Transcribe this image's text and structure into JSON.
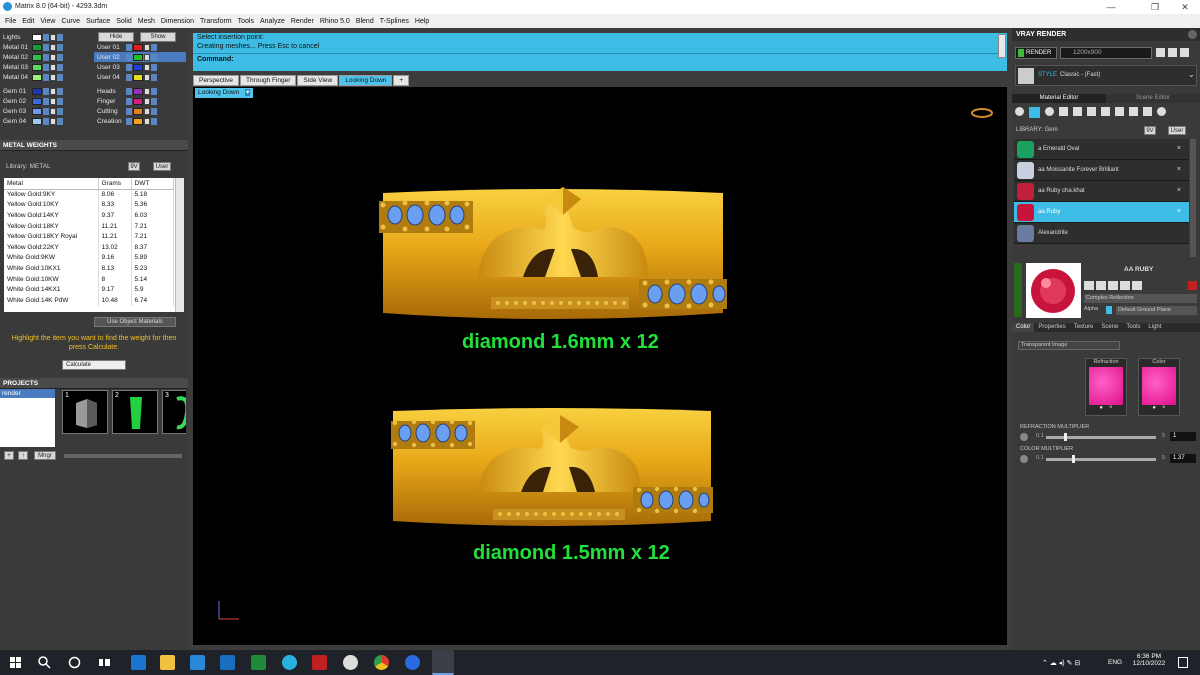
{
  "window": {
    "title": "Matrix 8.0 (64-bit) - 4293.3dm",
    "min": "—",
    "max": "❐",
    "close": "✕"
  },
  "menu": [
    "File",
    "Edit",
    "View",
    "Curve",
    "Surface",
    "Solid",
    "Mesh",
    "Dimension",
    "Transform",
    "Tools",
    "Analyze",
    "Render",
    "Rhino 5.0",
    "Blend",
    "T-Splines",
    "Help"
  ],
  "layers": {
    "hide_label": "Hide",
    "show_label": "Show",
    "left": [
      {
        "name": "Lights",
        "color": "#ffffff"
      },
      {
        "name": "Metal 01",
        "color": "#1a9a3a"
      },
      {
        "name": "Metal 02",
        "color": "#2ec24a"
      },
      {
        "name": "Metal 03",
        "color": "#5adc5a"
      },
      {
        "name": "Metal 04",
        "color": "#9af07a"
      },
      {
        "name": "Gem 01",
        "color": "#1a3ab0"
      },
      {
        "name": "Gem 02",
        "color": "#3a6ad8"
      },
      {
        "name": "Gem 03",
        "color": "#6a9ae8"
      },
      {
        "name": "Gem 04",
        "color": "#a0c8f4"
      }
    ],
    "right": [
      {
        "name": "User 01",
        "color": "#e02020"
      },
      {
        "name": "User 02",
        "color": "#20c020"
      },
      {
        "name": "User 03",
        "color": "#2040e0"
      },
      {
        "name": "User 04",
        "color": "#e0e020"
      },
      {
        "name": "Heads",
        "color": "#9a30c0"
      },
      {
        "name": "Finger",
        "color": "#d02080"
      },
      {
        "name": "Cutting",
        "color": "#e08020"
      },
      {
        "name": "Creation",
        "color": "#f0a020"
      }
    ]
  },
  "metal_weights": {
    "title": "METAL WEIGHTS",
    "library_label": "Library: METAL",
    "lib_btn1": "9V",
    "lib_btn2": "User",
    "headers": [
      "Metal",
      "Grams",
      "DWT"
    ],
    "rows": [
      [
        "Yellow Gold:9KY",
        "8.06",
        "5.18"
      ],
      [
        "Yellow Gold:10KY",
        "8.33",
        "5.36"
      ],
      [
        "Yellow Gold:14KY",
        "9.37",
        "6.03"
      ],
      [
        "Yellow Gold:18KY",
        "11.21",
        "7.21"
      ],
      [
        "Yellow Gold:18KY Royal",
        "11.21",
        "7.21"
      ],
      [
        "Yellow Gold:22KY",
        "13.02",
        "8.37"
      ],
      [
        "White Gold:9KW",
        "9.16",
        "5.89"
      ],
      [
        "White Gold:10KX1",
        "8.13",
        "5.23"
      ],
      [
        "White Gold:10KW",
        "8",
        "5.14"
      ],
      [
        "White Gold:14KX1",
        "9.17",
        "5.9"
      ],
      [
        "White Gold:14K PdW",
        "10.48",
        "6.74"
      ]
    ],
    "use_object_label": "Use Object Materials",
    "note": "Highlight the item you want to find the weight for then press Calculate.",
    "calculate_label": "Calculate"
  },
  "projects": {
    "title": "PROJECTS",
    "item": "render",
    "thumb_nums": [
      "1",
      "2",
      "3"
    ],
    "manager_label": "Mngr"
  },
  "command": {
    "line1": "Select insertion point:",
    "line2": "Creating meshes... Press Esc to cancel",
    "prompt": "Command:"
  },
  "viewtabs": [
    "Perspective",
    "Through Finger",
    "Side View",
    "Looking Down"
  ],
  "view_dropdown": "Looking Down",
  "captions": {
    "top": "diamond 1.6mm x 12",
    "bottom": "diamond 1.5mm x 12"
  },
  "vray": {
    "title": "VRAY RENDER",
    "render_btn": "RENDER",
    "resolution": "1200x900",
    "style_label": "STYLE",
    "style_value": "Classic - (Fast)",
    "tabs": [
      "Material Editor",
      "Scene Editor"
    ],
    "library_label": "LIBRARY: Gem",
    "lib_btn1": "9V",
    "lib_btn2": "User",
    "materials": [
      {
        "name": "a Emerald Oval",
        "color": "#1aa060"
      },
      {
        "name": "aa Moissanite Forever Brilliant",
        "color": "#c8d0e0"
      },
      {
        "name": "aa Ruby cha.khat",
        "color": "#c0203a"
      },
      {
        "name": "aa Ruby",
        "color": "#c8143a"
      },
      {
        "name": "Alexandrite",
        "color": "#6a7aa0"
      }
    ],
    "selected_name": "AA RUBY",
    "reflection": "Complex Reflection",
    "alpha_label": "Alpha",
    "ground_plane": "Default Ground Plane",
    "subtabs": [
      "Color",
      "Properties",
      "Texture",
      "Scene",
      "Tools",
      "Light"
    ],
    "transparent": "Transparent Image",
    "refraction_label": "Refraction",
    "color_label": "Color",
    "refraction_mult_label": "REFRACTION MULTIPLIER",
    "refraction_mult_value": "1",
    "color_mult_label": "COLOR MULTIPLIER",
    "color_mult_value": "1.37",
    "slider_min": "0.1",
    "slider_max": "5"
  },
  "taskbar": {
    "lang": "ENG",
    "time": "6:36 PM",
    "date": "12/10/2022"
  },
  "colors": {
    "accent": "#3dbde6",
    "gold": "#e0a820",
    "caption": "#22e03a"
  }
}
